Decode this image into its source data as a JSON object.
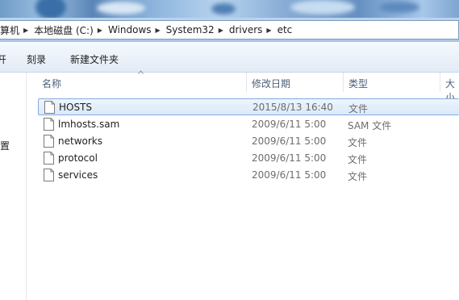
{
  "address_bar": {
    "crumbs": [
      "算机",
      "本地磁盘 (C:)",
      "Windows",
      "System32",
      "drivers",
      "etc"
    ]
  },
  "toolbar": {
    "partial_button": "开",
    "burn_label": "刻录",
    "new_folder_label": "新建文件夹"
  },
  "nav_pane": {
    "partial_item": "置"
  },
  "columns": {
    "name": "名称",
    "modified": "修改日期",
    "type": "类型",
    "size": "大小"
  },
  "files": [
    {
      "name": "HOSTS",
      "modified": "2015/8/13 16:40",
      "type": "文件",
      "selected": true
    },
    {
      "name": "lmhosts.sam",
      "modified": "2009/6/11 5:00",
      "type": "SAM 文件",
      "selected": false
    },
    {
      "name": "networks",
      "modified": "2009/6/11 5:00",
      "type": "文件",
      "selected": false
    },
    {
      "name": "protocol",
      "modified": "2009/6/11 5:00",
      "type": "文件",
      "selected": false
    },
    {
      "name": "services",
      "modified": "2009/6/11 5:00",
      "type": "文件",
      "selected": false
    }
  ],
  "icons": {
    "file": "blank-file-icon",
    "separator": "breadcrumb-chevron-icon",
    "sort": "sort-ascending-icon"
  },
  "colors": {
    "selection_border": "#84acdd",
    "selection_fill": "#dbe9f9",
    "toolbar_bg": "#e2ebf6",
    "header_text": "#4c607a"
  }
}
